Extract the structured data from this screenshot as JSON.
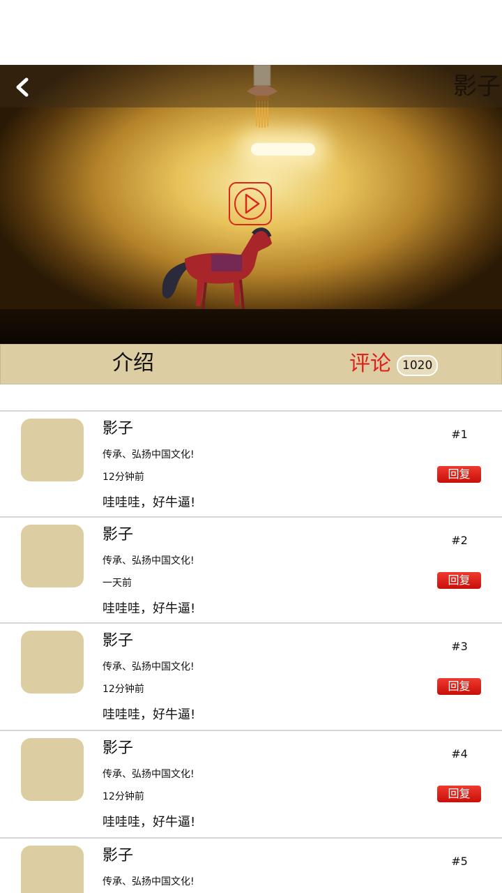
{
  "header": {
    "title": "影子",
    "back_icon": "chevron-left-icon"
  },
  "player": {
    "play_icon": "play-icon"
  },
  "tabs": {
    "intro_label": "介绍",
    "comments_label": "评论",
    "comments_count": "1020",
    "active": "comments",
    "active_color": "#e0201a",
    "tab_bg": "#dccda3"
  },
  "comments": [
    {
      "name": "影子",
      "slogan": "传承、弘扬中国文化!",
      "time": "12分钟前",
      "content": "哇哇哇，好牛逼!",
      "floor": "#1",
      "reply_label": "回复"
    },
    {
      "name": "影子",
      "slogan": "传承、弘扬中国文化!",
      "time": "一天前",
      "content": "哇哇哇，好牛逼!",
      "floor": "#2",
      "reply_label": "回复"
    },
    {
      "name": "影子",
      "slogan": "传承、弘扬中国文化!",
      "time": "12分钟前",
      "content": "哇哇哇，好牛逼!",
      "floor": "#3",
      "reply_label": "回复"
    },
    {
      "name": "影子",
      "slogan": "传承、弘扬中国文化!",
      "time": "12分钟前",
      "content": "哇哇哇，好牛逼!",
      "floor": "#4",
      "reply_label": "回复"
    },
    {
      "name": "影子",
      "slogan": "传承、弘扬中国文化!",
      "time": "",
      "content": "",
      "floor": "#5",
      "reply_label": ""
    }
  ],
  "colors": {
    "reply_button": "#d81a12",
    "avatar_placeholder": "#dccda3"
  }
}
